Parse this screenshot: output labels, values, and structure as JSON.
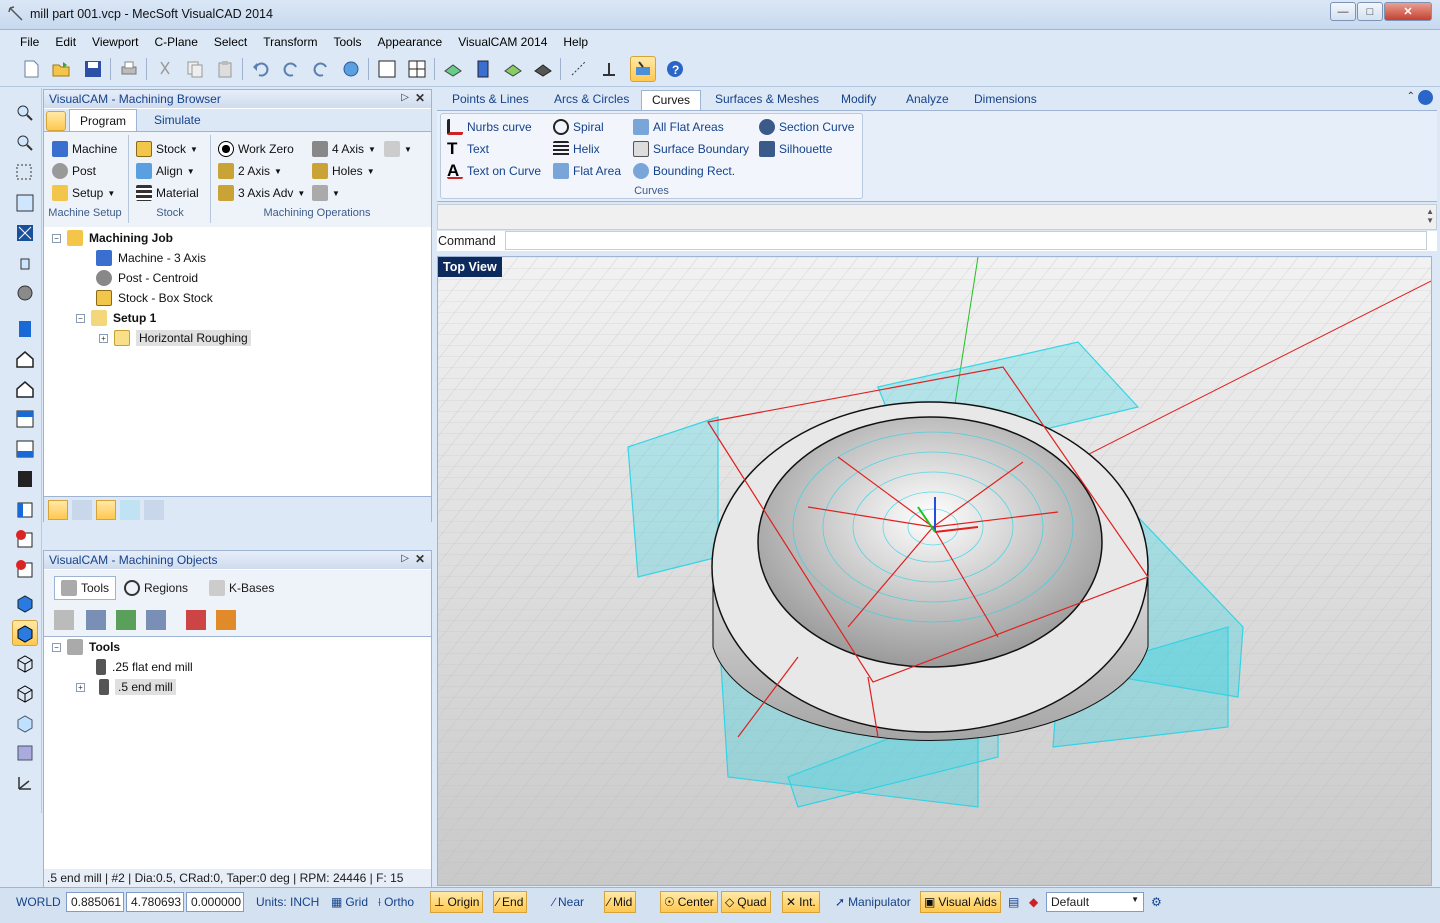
{
  "window": {
    "title": "mill part 001.vcp - MecSoft VisualCAD 2014"
  },
  "menu": [
    "File",
    "Edit",
    "Viewport",
    "C-Plane",
    "Select",
    "Transform",
    "Tools",
    "Appearance",
    "VisualCAM 2014",
    "Help"
  ],
  "browser": {
    "title": "VisualCAM - Machining Browser",
    "tabs": [
      "Program",
      "Simulate"
    ],
    "machine_setup": {
      "machine": "Machine",
      "post": "Post",
      "setup": "Setup",
      "group": "Machine Setup"
    },
    "stock": {
      "stock": "Stock",
      "align": "Align",
      "material": "Material",
      "group": "Stock"
    },
    "ops": {
      "work_zero": "Work Zero",
      "axis4": "4 Axis",
      "axis2": "2 Axis",
      "holes": "Holes",
      "axis3adv": "3 Axis Adv",
      "group": "Machining Operations"
    },
    "tree": {
      "job": "Machining Job",
      "machine": "Machine - 3 Axis",
      "post": "Post - Centroid",
      "stock": "Stock - Box Stock",
      "setup": "Setup 1",
      "op": "Horizontal Roughing"
    }
  },
  "objects": {
    "title": "VisualCAM - Machining Objects",
    "tabs": [
      "Tools",
      "Regions",
      "K-Bases"
    ],
    "tree": {
      "root": "Tools",
      "t1": ".25 flat end mill",
      "t2": ".5 end mill"
    },
    "info": ".5 end mill | #2 | Dia:0.5, CRad:0, Taper:0 deg | RPM: 24446 | F: 15"
  },
  "ribbon": {
    "tabs": [
      "Points & Lines",
      "Arcs & Circles",
      "Curves",
      "Surfaces & Meshes",
      "Modify",
      "Analyze",
      "Dimensions"
    ],
    "selected": "Curves",
    "buttons": {
      "nurbs": "Nurbs curve",
      "text": "Text",
      "textcurve": "Text on Curve",
      "spiral": "Spiral",
      "helix": "Helix",
      "flatarea": "Flat Area",
      "allflat": "All Flat Areas",
      "surfbound": "Surface Boundary",
      "bbox": "Bounding Rect.",
      "section": "Section Curve",
      "silhouette": "Silhouette"
    },
    "group": "Curves"
  },
  "command": {
    "label": "Command",
    "value": ""
  },
  "viewport": {
    "label": "Top View"
  },
  "status": {
    "world": "WORLD",
    "x": "0.885061",
    "y": "4.780693",
    "z": "0.000000",
    "units": "Units: INCH",
    "grid": "Grid",
    "ortho": "Ortho",
    "snaps": [
      "Origin",
      "End",
      "Near",
      "Mid",
      "Center",
      "Quad",
      "Int."
    ],
    "manipulator": "Manipulator",
    "visual_aids": "Visual Aids",
    "layer": "Default"
  },
  "colors": {
    "accent": "#ffc850",
    "toolpath": "#22d3e6",
    "red": "#e02020",
    "frame": "#dce8f5"
  }
}
